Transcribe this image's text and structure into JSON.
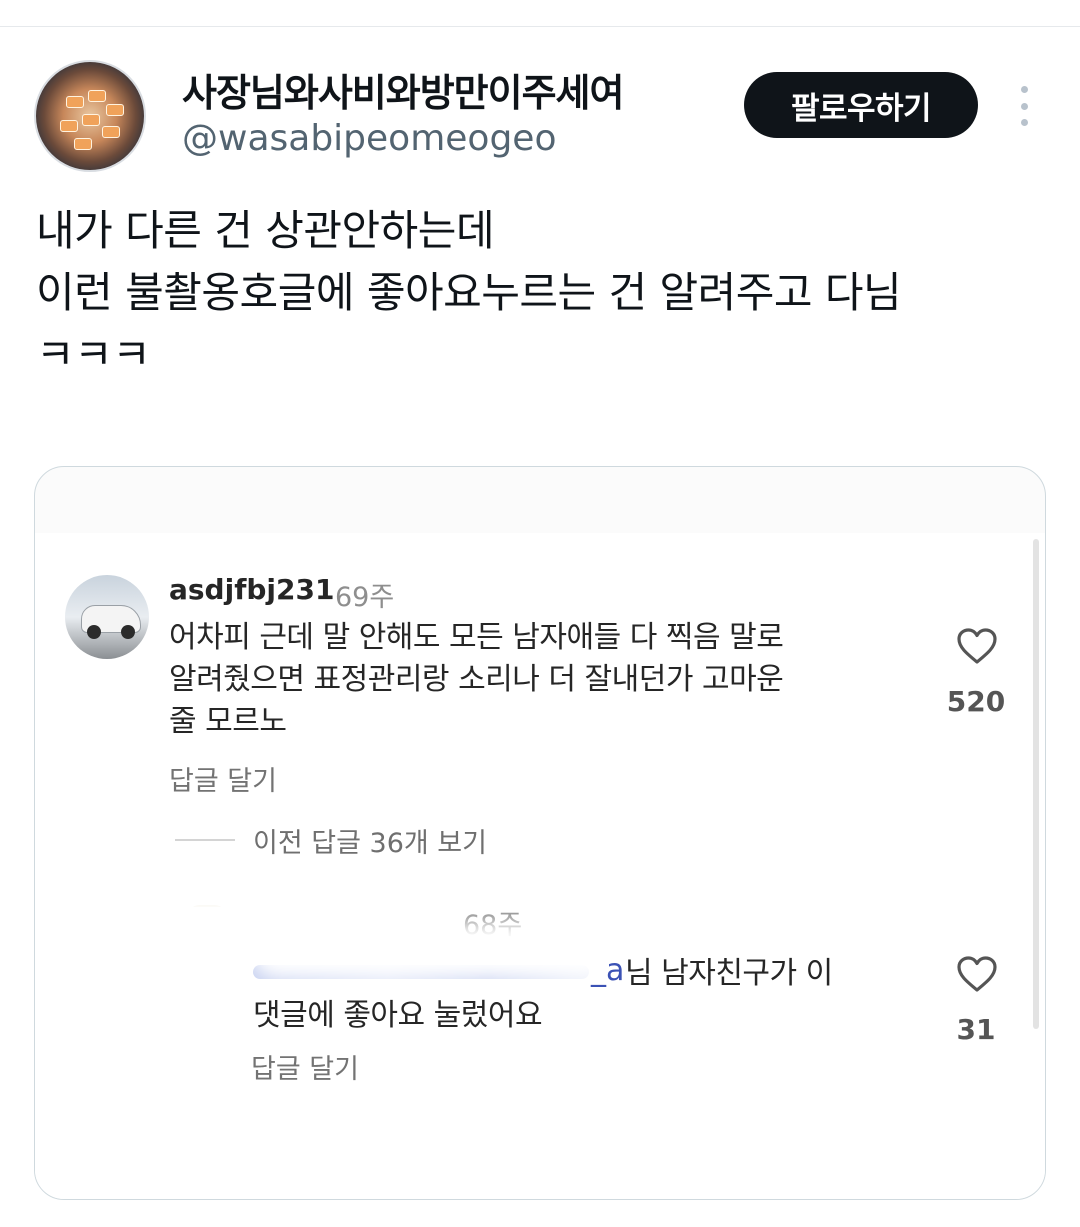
{
  "header": {
    "display_name": "사장님와사비와방만이주세여",
    "handle": "@wasabipeomeogeo",
    "follow_label": "팔로우하기"
  },
  "tweet": {
    "lines": [
      "내가 다른 건 상관안하는데",
      "이런 불촬옹호글에 좋아요누르는 건 알려주고 다님",
      "ㅋㅋㅋ"
    ]
  },
  "embedded": {
    "comment": {
      "username": "asdjfbj231",
      "time": "69주",
      "lines": [
        "어차피 근데 말 안해도 모든 남자애들 다 찍음 말로",
        "알려줬으면 표정관리랑 소리나 더 잘내던가 고마운",
        "줄 모르노"
      ],
      "reply_label": "답글 달기",
      "like_count": "520"
    },
    "view_replies_label": "이전 답글 36개 보기",
    "reply": {
      "time": "68주",
      "mention_tail": "_a",
      "line1": "님 남자친구가 이",
      "line2": "댓글에 좋아요 눌렀어요",
      "reply_label": "답글 달기",
      "like_count": "31"
    }
  },
  "icons": {
    "more": "more-vertical-icon",
    "like": "heart-outline-icon"
  },
  "colors": {
    "follow_button_bg": "#0f1419",
    "handle": "#536471",
    "mention": "#3b52b5"
  }
}
